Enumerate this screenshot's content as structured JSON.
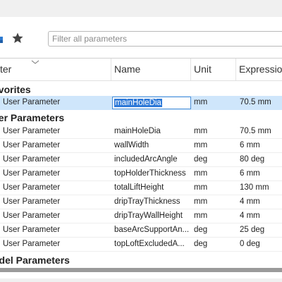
{
  "toolbar": {
    "filter_placeholder": "Filter all parameters",
    "icons": [
      "tool-icon",
      "star-icon"
    ]
  },
  "columns": {
    "col0": "ter",
    "name": "Name",
    "unit": "Unit",
    "expression": "Expressio"
  },
  "sections": {
    "favorites": "avorites",
    "user": "ser Parameters",
    "model": "odel Parameters"
  },
  "favorites": [
    {
      "type": "User Parameter",
      "name": "mainHoleDia",
      "unit": "mm",
      "expr": "70.5 mm",
      "selected": true
    }
  ],
  "user_rows": [
    {
      "type": "User Parameter",
      "name": "mainHoleDia",
      "unit": "mm",
      "expr": "70.5 mm"
    },
    {
      "type": "User Parameter",
      "name": "wallWidth",
      "unit": "mm",
      "expr": "6 mm"
    },
    {
      "type": "User Parameter",
      "name": "includedArcAngle",
      "unit": "deg",
      "expr": "80 deg"
    },
    {
      "type": "User Parameter",
      "name": "topHolderThickness",
      "unit": "mm",
      "expr": "6 mm"
    },
    {
      "type": "User Parameter",
      "name": "totalLiftHeight",
      "unit": "mm",
      "expr": "130 mm"
    },
    {
      "type": "User Parameter",
      "name": "dripTrayThickness",
      "unit": "mm",
      "expr": "4 mm"
    },
    {
      "type": "User Parameter",
      "name": "dripTrayWallHeight",
      "unit": "mm",
      "expr": "4 mm"
    },
    {
      "type": "User Parameter",
      "name": "baseArcSupportAn...",
      "unit": "deg",
      "expr": "25 deg"
    },
    {
      "type": "User Parameter",
      "name": "topLoftExcludedA...",
      "unit": "deg",
      "expr": "0 deg"
    }
  ],
  "colors": {
    "selection": "#cfe6fb",
    "editor_highlight": "#2f7ad8",
    "bottom_bar": "#9a9a9a"
  }
}
